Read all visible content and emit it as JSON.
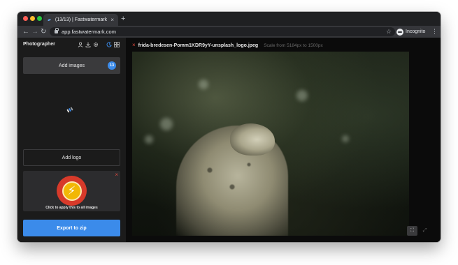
{
  "browser": {
    "tab_title": "(13/13) | Fastwatermark",
    "tab_close": "×",
    "new_tab": "+",
    "nav_back": "←",
    "nav_forward": "→",
    "nav_reload": "↻",
    "url": "app.fastwatermark.com",
    "star": "☆",
    "incognito_label": "Incognito",
    "menu": "⋮"
  },
  "sidebar": {
    "brand": "Photographer",
    "icons": {
      "user": "user-icon",
      "download": "download-icon",
      "settings": "gear-icon",
      "theme": "moon-icon",
      "grid": "grid-icon"
    },
    "add_images_label": "Add images",
    "image_count": "13",
    "add_logo_label": "Add logo",
    "logo_remove": "×",
    "logo_caption": "Click to apply this to all images",
    "export_label": "Export to zip"
  },
  "main": {
    "file_remove": "×",
    "file_name": "frida-bredesen-Pomm1KDR9yY-unsplash_logo.jpeg",
    "scale_text": "Scale from 5184px to 1500px"
  },
  "colors": {
    "accent": "#3b8bea",
    "danger": "#e0493e",
    "sidebar_bg": "#1b1b1b",
    "app_bg": "#0b0b0b"
  }
}
